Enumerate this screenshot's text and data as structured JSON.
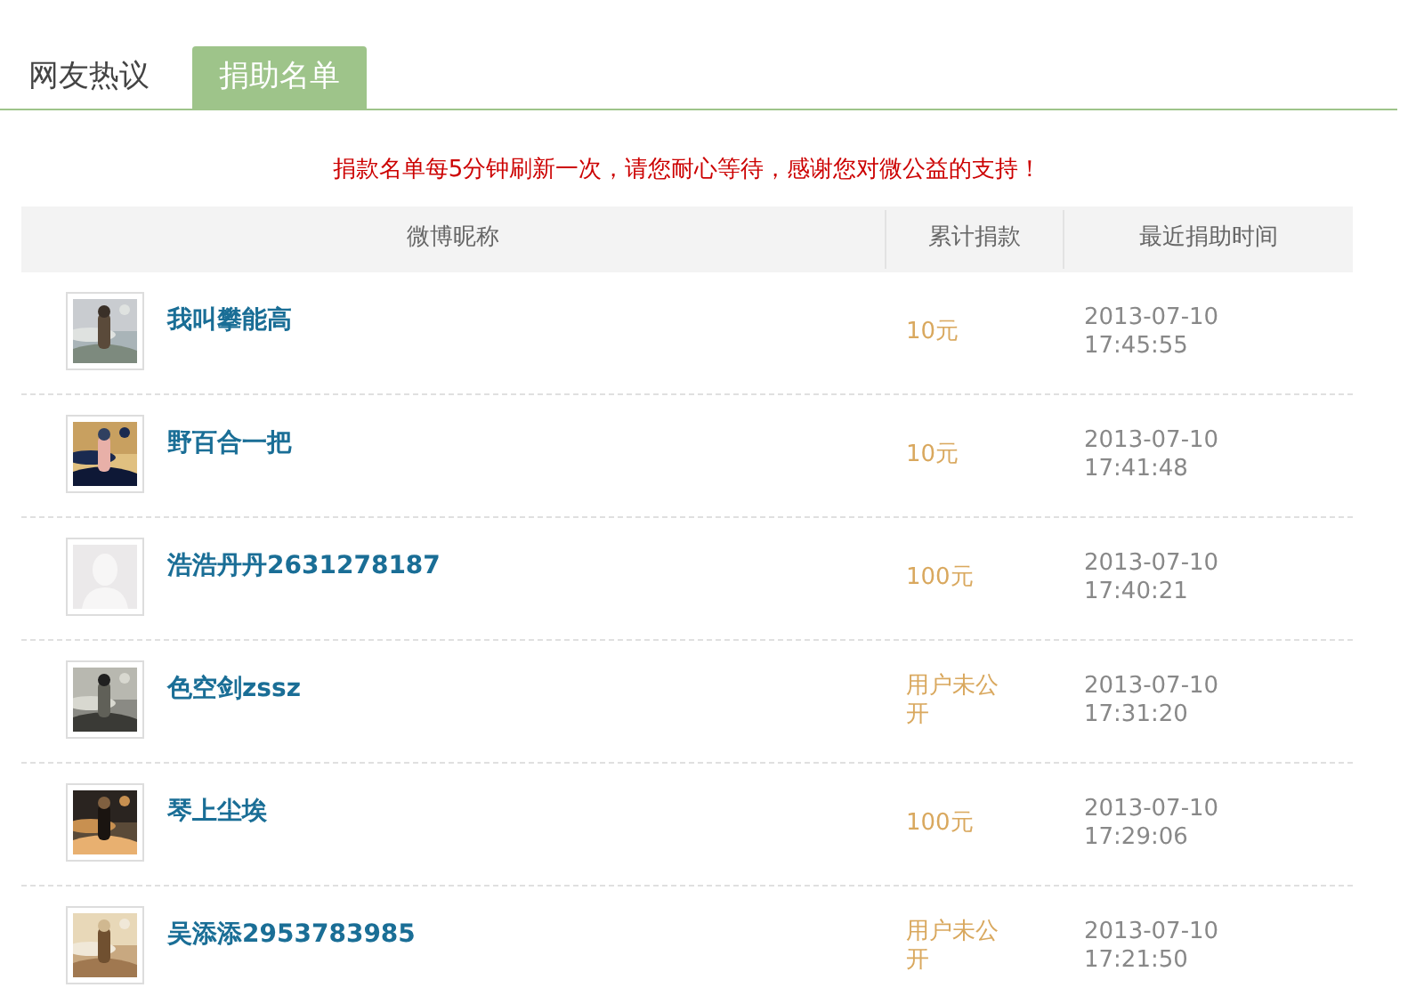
{
  "tabs": [
    {
      "label": "网友热议",
      "selected": false
    },
    {
      "label": "捐助名单",
      "selected": true
    }
  ],
  "notice": "捐款名单每5分钟刷新一次，请您耐心等待，感谢您对微公益的支持！",
  "table": {
    "columns": [
      "微博昵称",
      "累计捐款",
      "最近捐助时间"
    ],
    "rows": [
      {
        "nickname": "我叫攀能高",
        "amount": "10元",
        "time": "2013-07-10 17:45:55"
      },
      {
        "nickname": "野百合一把",
        "amount": "10元",
        "time": "2013-07-10 17:41:48"
      },
      {
        "avatar": {
          "kind": "silhouette"
        },
        "nickname": "浩浩丹丹2631278187",
        "amount": "100元",
        "time": "2013-07-10 17:40:21"
      },
      {
        "nickname": "色空剑zssz",
        "amount": "用户未公开",
        "time": "2013-07-10 17:31:20"
      },
      {
        "nickname": "琴上尘埃",
        "amount": "100元",
        "time": "2013-07-10 17:29:06"
      },
      {
        "nickname": "吴添添2953783985",
        "amount": "用户未公开",
        "time": "2013-07-10 17:21:50"
      }
    ]
  }
}
